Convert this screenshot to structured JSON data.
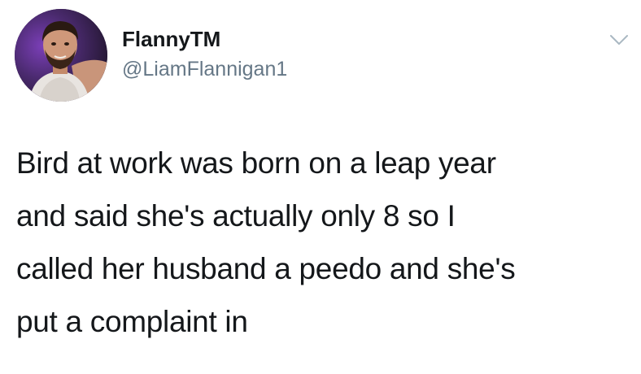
{
  "author": {
    "display_name": "FlannyTM",
    "handle": "@LiamFlannigan1",
    "avatar_icon": "profile-photo"
  },
  "menu": {
    "icon": "chevron-down-icon",
    "color": "#aab8c2"
  },
  "tweet": {
    "lines": [
      "Bird at work was born on a leap year",
      "and said she's actually only 8 so I",
      "called her husband a peedo and she's",
      "put a complaint in"
    ]
  },
  "colors": {
    "text": "#14171a",
    "secondary_text": "#657786",
    "background": "#ffffff"
  }
}
